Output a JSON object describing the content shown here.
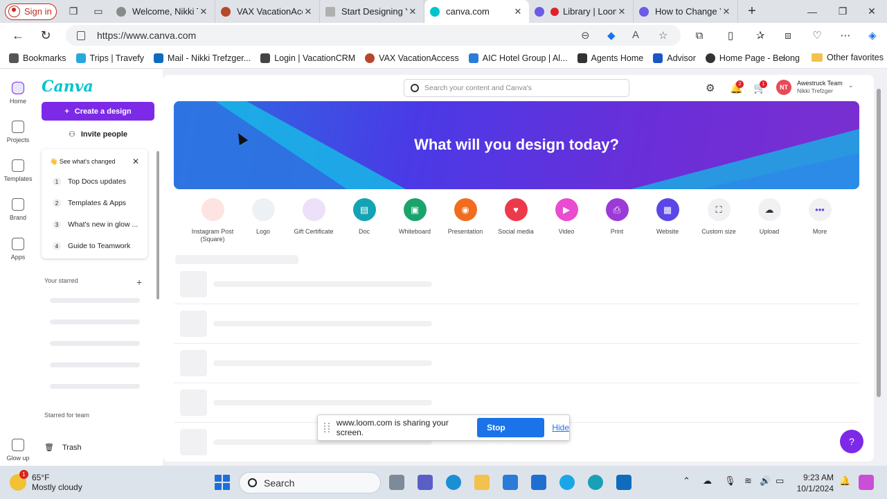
{
  "browser": {
    "signin_label": "Sign in",
    "tabs": [
      {
        "label": "Welcome, Nikki Tre",
        "color": "#8a8a8a"
      },
      {
        "label": "VAX VacationAcces",
        "color": "#b7472a"
      },
      {
        "label": "Start Designing Yo",
        "color": "#b0b0b0"
      },
      {
        "label": "canva.com",
        "color": "#00c4cc"
      },
      {
        "label": "Library | Loom",
        "color": "#6b5ce7"
      },
      {
        "label": "How to Change Yo",
        "color": "#6b5ce7"
      }
    ],
    "url": "https://www.canva.com",
    "bookmarks": [
      {
        "label": "Bookmarks",
        "color": "#555555"
      },
      {
        "label": "Trips | Travefy",
        "color": "#2aa7de"
      },
      {
        "label": "Mail - Nikki Trefzger...",
        "color": "#0f6cbd"
      },
      {
        "label": "Login | VacationCRM",
        "color": "#444444"
      },
      {
        "label": "VAX VacationAccess",
        "color": "#b7472a"
      },
      {
        "label": "AIC Hotel Group | Al...",
        "color": "#2b7bd9"
      },
      {
        "label": "Agents Home",
        "color": "#333333"
      },
      {
        "label": "Advisor",
        "color": "#1a56c4"
      },
      {
        "label": "Home Page - Belong",
        "color": "#333333"
      }
    ],
    "other_favorites": "Other favorites"
  },
  "canva": {
    "rail": [
      {
        "label": "Home",
        "icon": "home-icon"
      },
      {
        "label": "Projects",
        "icon": "folder-icon"
      },
      {
        "label": "Templates",
        "icon": "templates-icon"
      },
      {
        "label": "Brand",
        "icon": "brand-icon"
      },
      {
        "label": "Apps",
        "icon": "apps-icon"
      }
    ],
    "glow_up": "Glow up",
    "logo": "Canva",
    "create_label": "Create a design",
    "invite_label": "Invite people",
    "whats_new": {
      "title": "👋 See what's changed",
      "items": [
        {
          "num": "1",
          "label": "Top Docs updates"
        },
        {
          "num": "2",
          "label": "Templates & Apps"
        },
        {
          "num": "3",
          "label": "What's new in glow ..."
        },
        {
          "num": "4",
          "label": "Guide to Teamwork"
        }
      ]
    },
    "your_starred": "Your starred",
    "starred_for_team": "Starred for team",
    "trash": "Trash",
    "search_placeholder": "Search your content and Canva's",
    "notifications_count": "2",
    "cart_count": "1",
    "account": {
      "initials": "NT",
      "team": "Awestruck Team",
      "name": "Nikki Trefzger"
    },
    "hero_title": "What will you design today?",
    "design_types": [
      {
        "label": "Instagram Post (Square)",
        "color": "#fde3e1"
      },
      {
        "label": "Logo",
        "color": "#eef1f3"
      },
      {
        "label": "Gift Certificate",
        "color": "#ece0fb"
      },
      {
        "label": "Doc",
        "color": "#13a3b5"
      },
      {
        "label": "Whiteboard",
        "color": "#1aa36b"
      },
      {
        "label": "Presentation",
        "color": "#f26c1d"
      },
      {
        "label": "Social media",
        "color": "#ec3a4b"
      },
      {
        "label": "Video",
        "color": "#e94cd0"
      },
      {
        "label": "Print",
        "color": "#9b3ad6"
      },
      {
        "label": "Website",
        "color": "#5b46e8"
      },
      {
        "label": "Custom size",
        "color": "#f1f1f4"
      },
      {
        "label": "Upload",
        "color": "#f1f1f4"
      },
      {
        "label": "More",
        "color": "#f1f1f4"
      }
    ],
    "help_label": "?"
  },
  "share_bar": {
    "message": "www.loom.com is sharing your screen.",
    "stop_label": "Stop sharing",
    "hide_label": "Hide"
  },
  "taskbar": {
    "weather_badge": "1",
    "temperature": "65°F",
    "condition": "Mostly cloudy",
    "search_label": "Search",
    "time": "9:23 AM",
    "date": "10/1/2024"
  }
}
